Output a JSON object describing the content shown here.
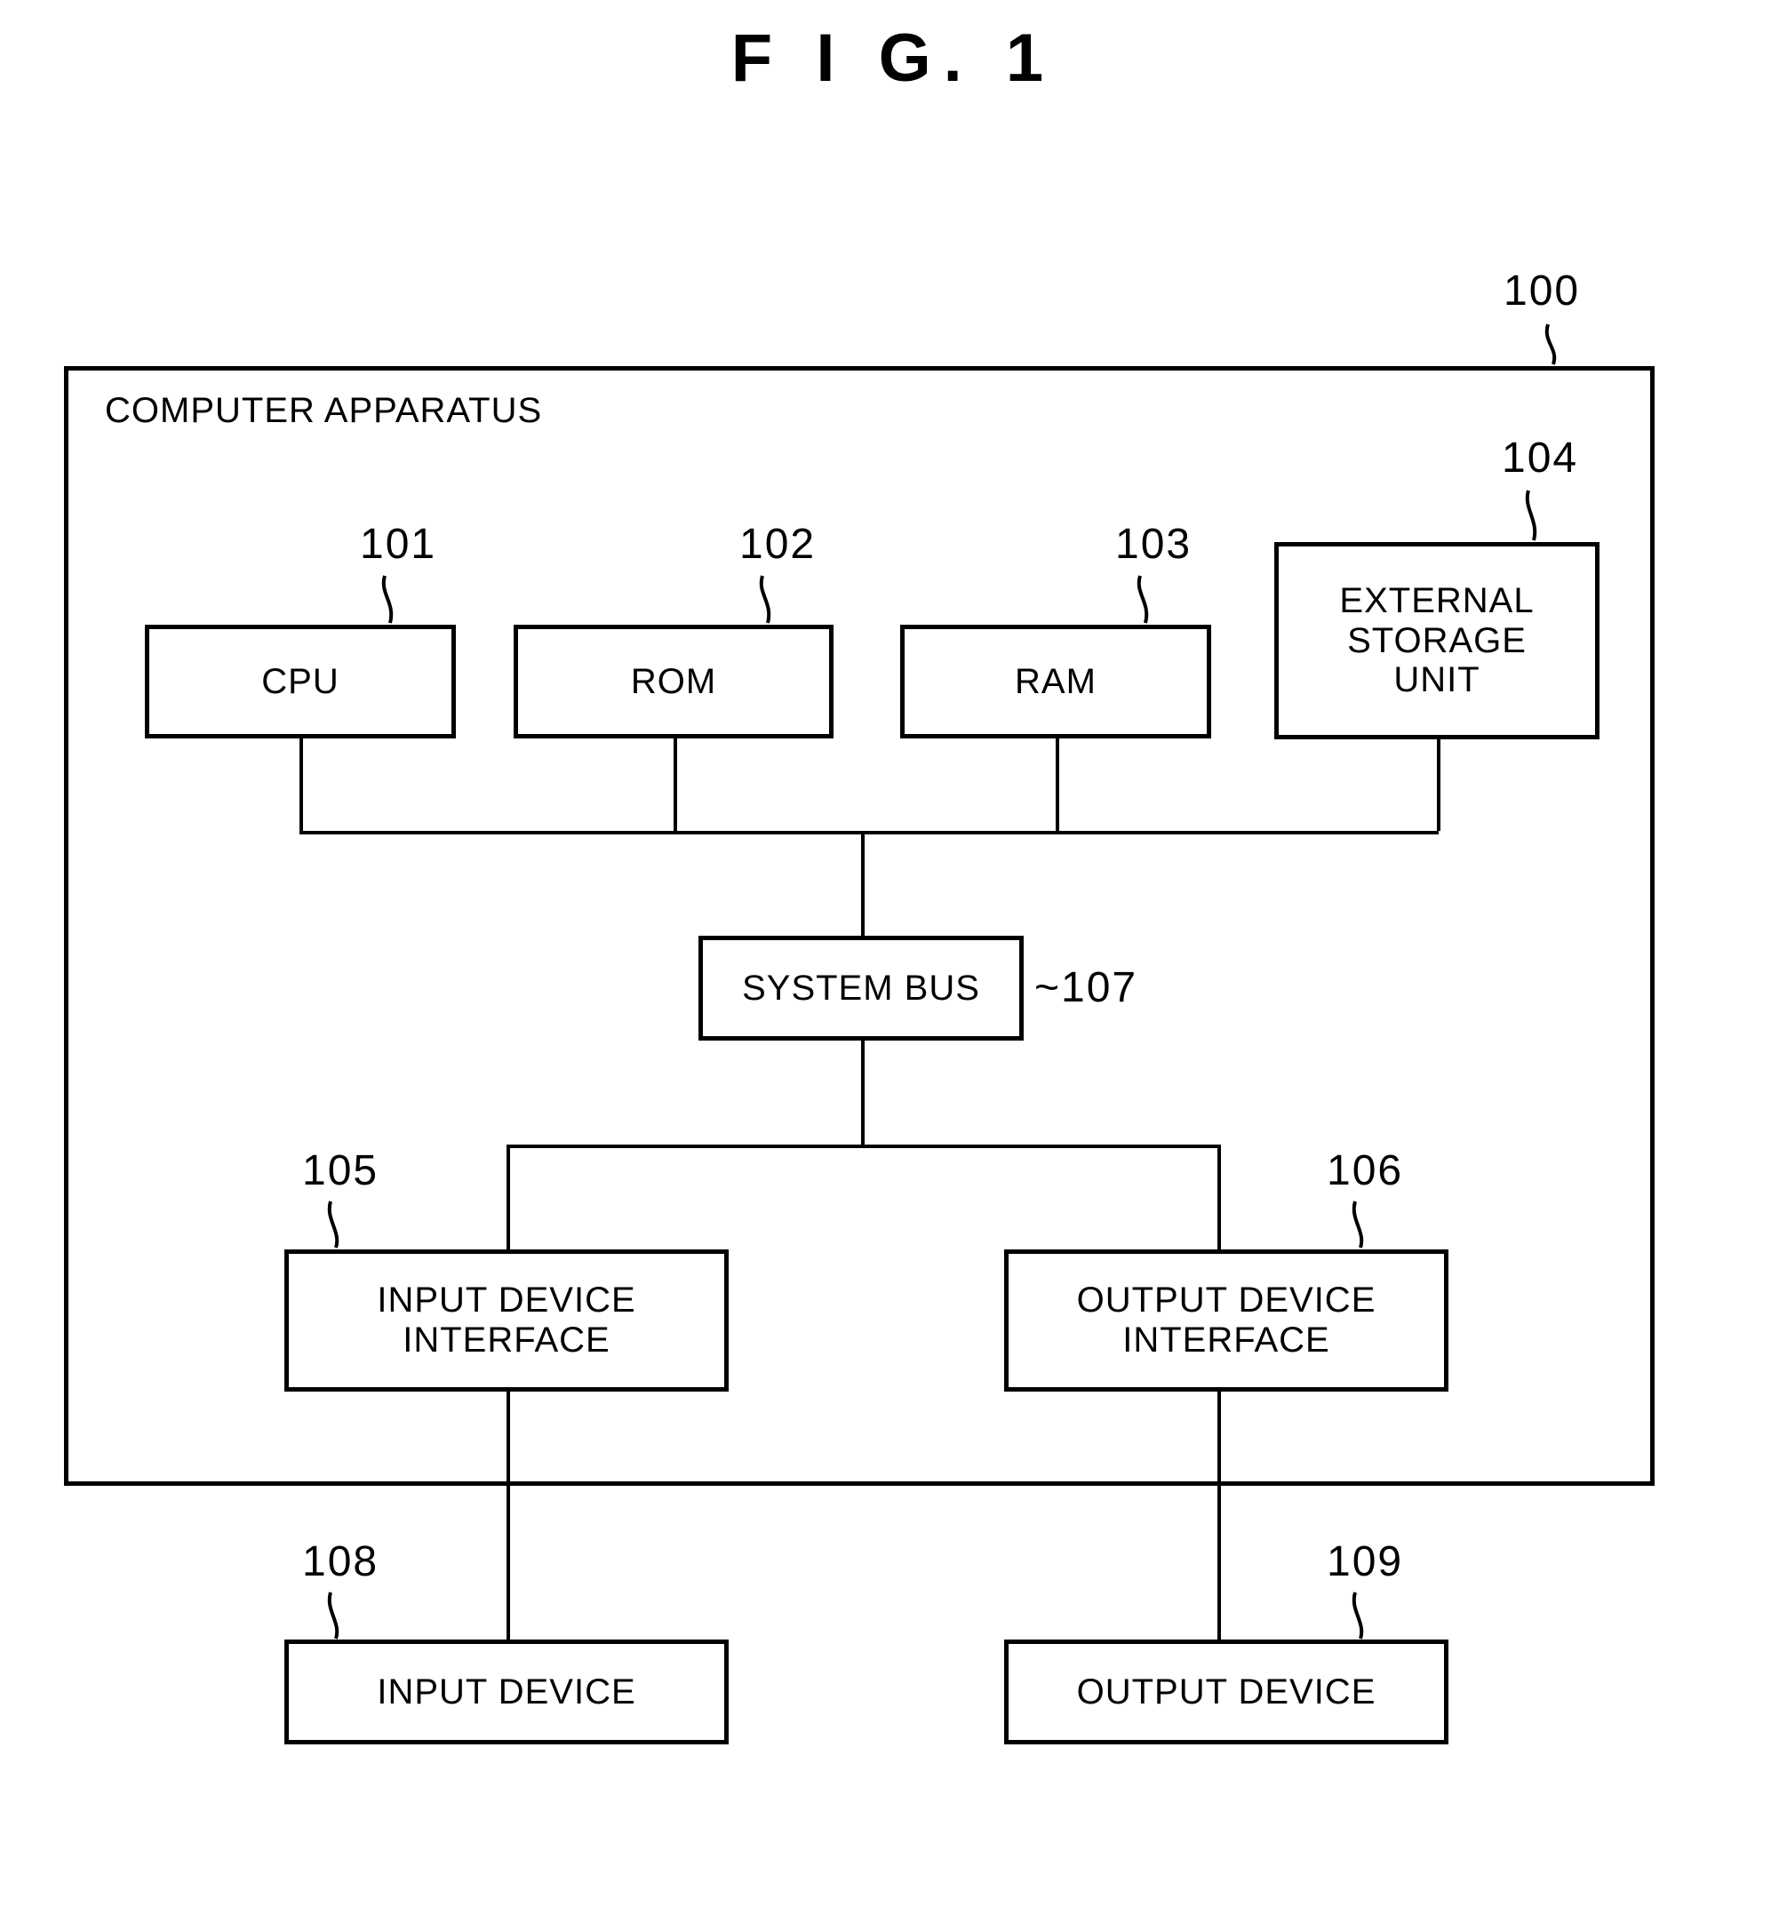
{
  "figure": {
    "title": "F I G.  1"
  },
  "outer": {
    "label": "COMPUTER APPARATUS",
    "ref": "100"
  },
  "blocks": [
    {
      "id": "cpu",
      "label": "CPU",
      "ref": "101"
    },
    {
      "id": "rom",
      "label": "ROM",
      "ref": "102"
    },
    {
      "id": "ram",
      "label": "RAM",
      "ref": "103"
    },
    {
      "id": "ext-store",
      "label": "EXTERNAL\nSTORAGE\nUNIT",
      "ref": "104"
    },
    {
      "id": "sys-bus",
      "label": "SYSTEM BUS",
      "ref": "107"
    },
    {
      "id": "in-iface",
      "label": "INPUT DEVICE\nINTERFACE",
      "ref": "105"
    },
    {
      "id": "out-iface",
      "label": "OUTPUT DEVICE\nINTERFACE",
      "ref": "106"
    },
    {
      "id": "in-dev",
      "label": "INPUT DEVICE",
      "ref": "108"
    },
    {
      "id": "out-dev",
      "label": "OUTPUT DEVICE",
      "ref": "109"
    }
  ],
  "labels": {
    "cpu": "CPU",
    "rom": "ROM",
    "ram": "RAM",
    "ext_storage_l1": "EXTERNAL",
    "ext_storage_l2": "STORAGE",
    "ext_storage_l3": "UNIT",
    "system_bus": "SYSTEM BUS",
    "input_iface_l1": "INPUT DEVICE",
    "input_iface_l2": "INTERFACE",
    "output_iface_l1": "OUTPUT DEVICE",
    "output_iface_l2": "INTERFACE",
    "input_device": "INPUT DEVICE",
    "output_device": "OUTPUT DEVICE"
  },
  "refs": {
    "apparatus": "100",
    "cpu": "101",
    "rom": "102",
    "ram": "103",
    "ext_storage": "104",
    "input_iface": "105",
    "output_iface": "106",
    "system_bus": "~107",
    "input_device": "108",
    "output_device": "109"
  },
  "colors": {
    "ink": "#000000",
    "paper": "#ffffff"
  }
}
